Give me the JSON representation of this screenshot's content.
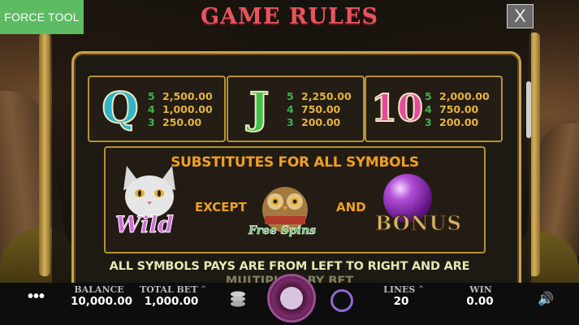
{
  "force_tool": "FORCE TOOL",
  "title": "GAME RULES",
  "close": "X",
  "symbols": [
    {
      "glyph": "Q",
      "color": "#2fb5c9",
      "pays": [
        {
          "n": "5",
          "v": "2,500.00"
        },
        {
          "n": "4",
          "v": "1,000.00"
        },
        {
          "n": "3",
          "v": "250.00"
        }
      ]
    },
    {
      "glyph": "J",
      "color": "#3ec44a",
      "pays": [
        {
          "n": "5",
          "v": "2,250.00"
        },
        {
          "n": "4",
          "v": "750.00"
        },
        {
          "n": "3",
          "v": "200.00"
        }
      ]
    },
    {
      "glyph": "10",
      "color": "#e44a9c",
      "pays": [
        {
          "n": "5",
          "v": "2,000.00"
        },
        {
          "n": "4",
          "v": "750.00"
        },
        {
          "n": "3",
          "v": "200.00"
        }
      ]
    }
  ],
  "wild": {
    "heading": "SUBSTITUTES FOR ALL SYMBOLS",
    "except": "EXCEPT",
    "and": "AND",
    "wild_label": "Wild",
    "freespins_label": "Free Spins",
    "bonus_label": "BONUS"
  },
  "footer_line1": "ALL SYMBOLS PAYS ARE FROM LEFT TO RIGHT AND ARE",
  "footer_line2": "MULTIPLIED BY BET",
  "bar": {
    "balance_label": "BALANCE",
    "balance_value": "10,000.00",
    "total_bet_label": "TOTAL BET",
    "total_bet_value": "1,000.00",
    "lines_label": "LINES",
    "lines_value": "20",
    "win_label": "WIN",
    "win_value": "0.00"
  }
}
